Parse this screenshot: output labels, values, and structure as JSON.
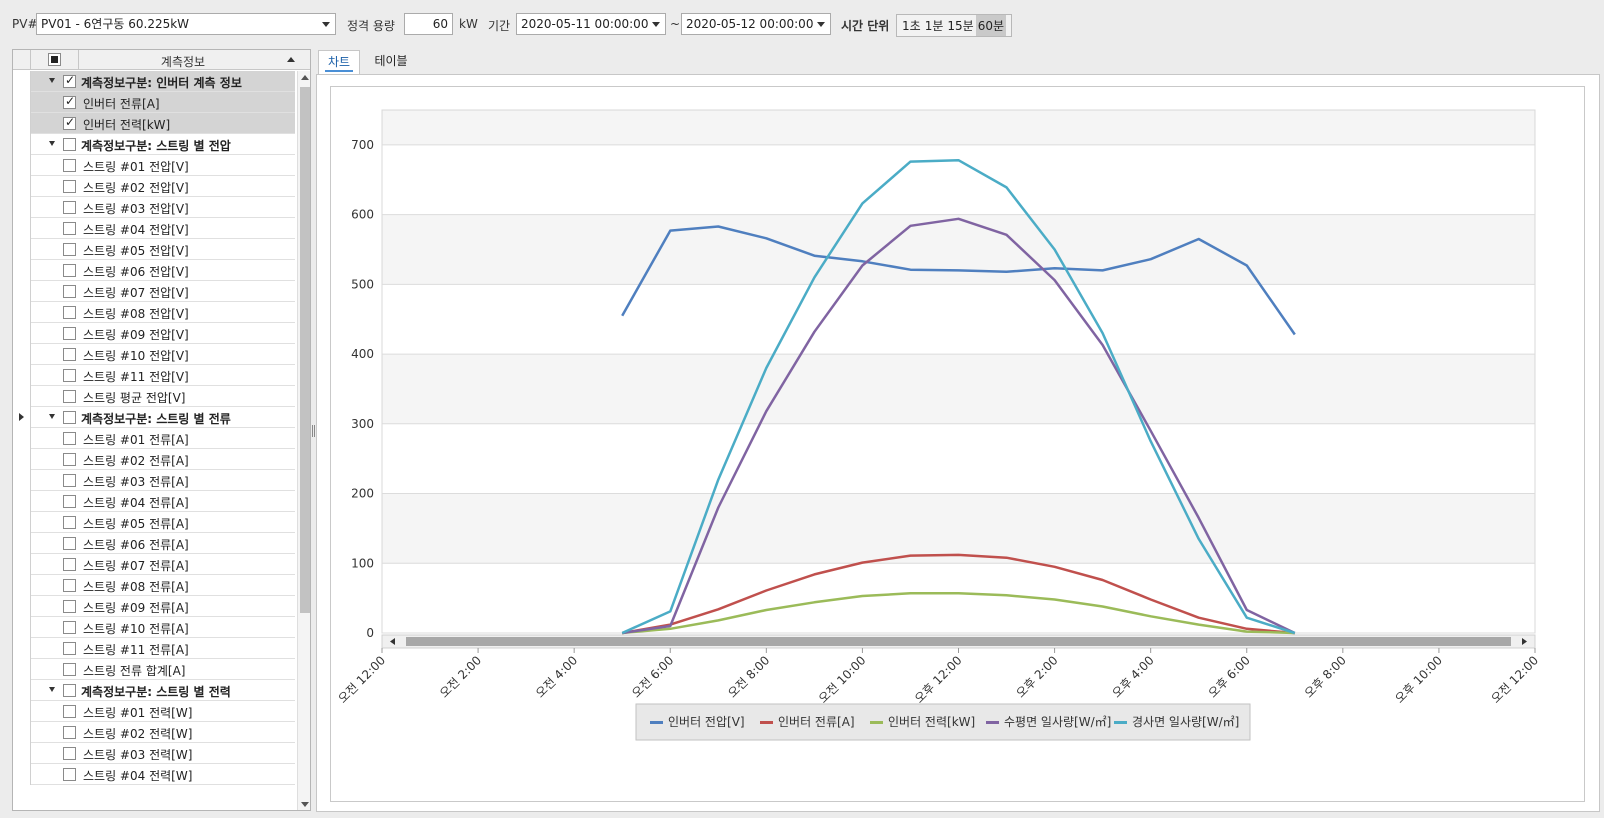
{
  "toolbar": {
    "pv_label": "PV#",
    "pv_value": "PV01 - 6연구동 60.225kW",
    "capacity_label": "정격 용량",
    "capacity_value": "60",
    "capacity_unit": "kW",
    "period_label": "기간",
    "start_date": "2020-05-11 00:00:00",
    "tilde": "~",
    "end_date": "2020-05-12 00:00:00",
    "time_unit_label": "시간 단위",
    "time_units": [
      "1초",
      "1분",
      "15분",
      "60분"
    ],
    "time_unit_selected": "60분"
  },
  "tree": {
    "header": "계측정보",
    "groups": [
      {
        "label": "계측정보구분: 인버터 계측 정보",
        "checked": true,
        "items": [
          {
            "label": "인버터 전류[A]",
            "checked": true
          },
          {
            "label": "인버터 전력[kW]",
            "checked": true
          }
        ]
      },
      {
        "label": "계측정보구분: 스트링 별 전압",
        "checked": false,
        "items": [
          {
            "label": "스트링 #01 전압[V]",
            "checked": false
          },
          {
            "label": "스트링 #02 전압[V]",
            "checked": false
          },
          {
            "label": "스트링 #03 전압[V]",
            "checked": false
          },
          {
            "label": "스트링 #04 전압[V]",
            "checked": false
          },
          {
            "label": "스트링 #05 전압[V]",
            "checked": false
          },
          {
            "label": "스트링 #06 전압[V]",
            "checked": false
          },
          {
            "label": "스트링 #07 전압[V]",
            "checked": false
          },
          {
            "label": "스트링 #08 전압[V]",
            "checked": false
          },
          {
            "label": "스트링 #09 전압[V]",
            "checked": false
          },
          {
            "label": "스트링 #10 전압[V]",
            "checked": false
          },
          {
            "label": "스트링 #11 전압[V]",
            "checked": false
          },
          {
            "label": "스트링 평균 전압[V]",
            "checked": false
          }
        ]
      },
      {
        "label": "계측정보구분: 스트링 별 전류",
        "checked": false,
        "items": [
          {
            "label": "스트링 #01 전류[A]",
            "checked": false
          },
          {
            "label": "스트링 #02 전류[A]",
            "checked": false
          },
          {
            "label": "스트링 #03 전류[A]",
            "checked": false
          },
          {
            "label": "스트링 #04 전류[A]",
            "checked": false
          },
          {
            "label": "스트링 #05 전류[A]",
            "checked": false
          },
          {
            "label": "스트링 #06 전류[A]",
            "checked": false
          },
          {
            "label": "스트링 #07 전류[A]",
            "checked": false
          },
          {
            "label": "스트링 #08 전류[A]",
            "checked": false
          },
          {
            "label": "스트링 #09 전류[A]",
            "checked": false
          },
          {
            "label": "스트링 #10 전류[A]",
            "checked": false
          },
          {
            "label": "스트링 #11 전류[A]",
            "checked": false
          },
          {
            "label": "스트링 전류 합계[A]",
            "checked": false
          }
        ]
      },
      {
        "label": "계측정보구분: 스트링 별 전력",
        "checked": false,
        "items": [
          {
            "label": "스트링 #01 전력[W]",
            "checked": false
          },
          {
            "label": "스트링 #02 전력[W]",
            "checked": false
          },
          {
            "label": "스트링 #03 전력[W]",
            "checked": false
          },
          {
            "label": "스트링 #04 전력[W]",
            "checked": false
          }
        ]
      }
    ]
  },
  "tabs": [
    {
      "label": "차트",
      "active": true
    },
    {
      "label": "테이블",
      "active": false
    }
  ],
  "chart_data": {
    "type": "line",
    "ylim": [
      0,
      750
    ],
    "yticks": [
      0,
      100,
      200,
      300,
      400,
      500,
      600,
      700
    ],
    "xlim": [
      0,
      24
    ],
    "xticks": [
      {
        "h": 0,
        "label": "오전 12:00"
      },
      {
        "h": 2,
        "label": "오전 2:00"
      },
      {
        "h": 4,
        "label": "오전 4:00"
      },
      {
        "h": 6,
        "label": "오전 6:00"
      },
      {
        "h": 8,
        "label": "오전 8:00"
      },
      {
        "h": 10,
        "label": "오전 10:00"
      },
      {
        "h": 12,
        "label": "오후 12:00"
      },
      {
        "h": 14,
        "label": "오후 2:00"
      },
      {
        "h": 16,
        "label": "오후 4:00"
      },
      {
        "h": 18,
        "label": "오후 6:00"
      },
      {
        "h": 20,
        "label": "오후 8:00"
      },
      {
        "h": 22,
        "label": "오후 10:00"
      },
      {
        "h": 24,
        "label": "오전 12:00"
      }
    ],
    "x": [
      5,
      6,
      7,
      8,
      9,
      10,
      11,
      12,
      13,
      14,
      15,
      16,
      17,
      18,
      19
    ],
    "series": [
      {
        "name": "인버터 전압[V]",
        "color": "#4f7fbf",
        "values": [
          455,
          577,
          583,
          566,
          541,
          533,
          521,
          520,
          518,
          523,
          520,
          536,
          565,
          527,
          428
        ]
      },
      {
        "name": "인버터 전류[A]",
        "color": "#c0504d",
        "values": [
          0,
          12,
          34,
          61,
          84,
          101,
          111,
          112,
          108,
          95,
          76,
          48,
          22,
          6,
          0
        ]
      },
      {
        "name": "인버터 전력[kW]",
        "color": "#9bbb59",
        "values": [
          0,
          6,
          18,
          33,
          44,
          53,
          57,
          57,
          54,
          48,
          38,
          24,
          12,
          2,
          0
        ]
      },
      {
        "name": "수평면 일사량[W/㎡]",
        "color": "#8064a2",
        "values": [
          0,
          10,
          180,
          318,
          432,
          527,
          584,
          594,
          571,
          506,
          413,
          290,
          165,
          33,
          0
        ]
      },
      {
        "name": "경사면 일사량[W/㎡]",
        "color": "#4bacc6",
        "values": [
          0,
          31,
          220,
          380,
          510,
          616,
          676,
          678,
          639,
          550,
          430,
          275,
          135,
          22,
          0
        ]
      }
    ],
    "grid": true,
    "legend_position": "bottom-center"
  }
}
